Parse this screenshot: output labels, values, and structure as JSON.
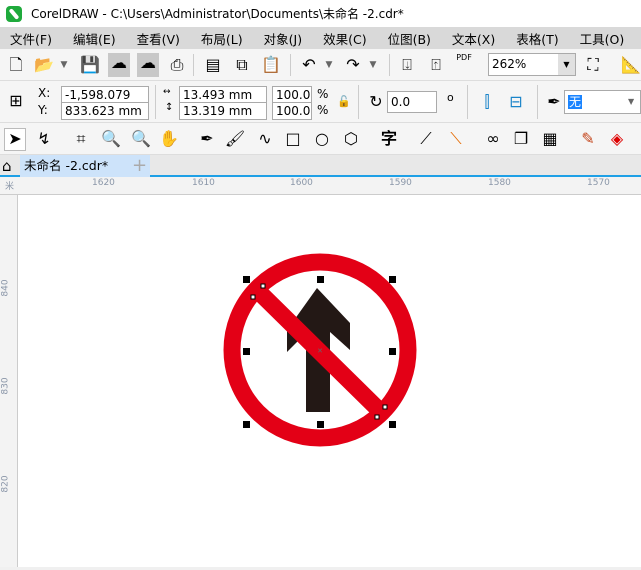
{
  "window": {
    "title": "CorelDRAW - C:\\Users\\Administrator\\Documents\\未命名 -2.cdr*"
  },
  "menu": [
    "文件(F)",
    "编辑(E)",
    "查看(V)",
    "布局(L)",
    "对象(J)",
    "效果(C)",
    "位图(B)",
    "文本(X)",
    "表格(T)",
    "工具(O)"
  ],
  "toolbar": {
    "zoom": "262%",
    "pdf_label": "PDF"
  },
  "properties": {
    "x_label": "X:",
    "y_label": "Y:",
    "x": "-1,598.079 mm",
    "y": "833.623 mm",
    "width": "13.493 mm",
    "height": "13.319 mm",
    "scale_w": "100.0",
    "scale_h": "100.0",
    "percent": "%",
    "rotation": "0.0",
    "degree": "o",
    "outline": "无"
  },
  "document_tab": {
    "label": "未命名 -2.cdr*",
    "add": "+"
  },
  "ruler": {
    "h_labels": [
      "1620",
      "1610",
      "1600",
      "1590",
      "1580",
      "1570"
    ],
    "v_labels": [
      "840",
      "830",
      "820"
    ],
    "unit": "米"
  },
  "colors": {
    "sign_red": "#e30016",
    "arrow": "#231815",
    "accent": "#1ea0e6"
  }
}
